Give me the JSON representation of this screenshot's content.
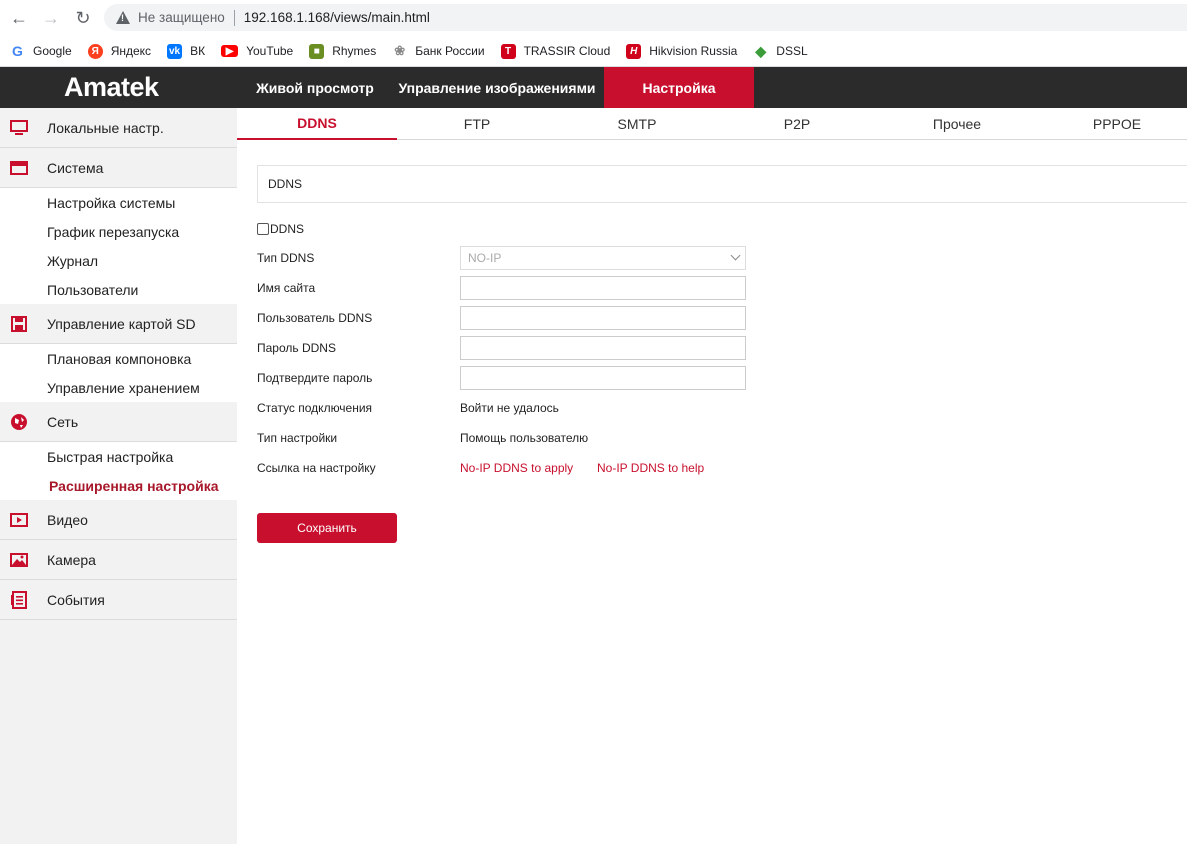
{
  "browser": {
    "insecure_label": "Не защищено",
    "url": "192.168.1.168/views/main.html",
    "bookmarks": [
      {
        "label": "Google",
        "icon": "google-icon",
        "color": "#4285f4"
      },
      {
        "label": "Яндекс",
        "icon": "yandex-icon",
        "color": "#fc3f1d"
      },
      {
        "label": "ВК",
        "icon": "vk-icon",
        "color": "#0077ff"
      },
      {
        "label": "YouTube",
        "icon": "youtube-icon",
        "color": "#ff0000"
      },
      {
        "label": "Rhymes",
        "icon": "rhymes-icon",
        "color": "#6b8e23"
      },
      {
        "label": "Банк России",
        "icon": "cbr-icon",
        "color": "#888888"
      },
      {
        "label": "TRASSIR Cloud",
        "icon": "trassir-icon",
        "color": "#d0021b"
      },
      {
        "label": "Hikvision Russia",
        "icon": "hikvision-icon",
        "color": "#d0021b"
      },
      {
        "label": "DSSL",
        "icon": "dssl-icon",
        "color": "#3a9d3a"
      }
    ]
  },
  "header": {
    "logo": "Amatek",
    "nav": [
      "Живой просмотр",
      "Управление изображениями",
      "Настройка"
    ],
    "active_nav": "Настройка"
  },
  "sidebar": {
    "local": "Локальные настр.",
    "system": "Система",
    "system_items": [
      "Настройка системы",
      "График перезапуска",
      "Журнал",
      "Пользователи"
    ],
    "sd": "Управление картой SD",
    "sd_items": [
      "Плановая компоновка",
      "Управление хранением"
    ],
    "network": "Сеть",
    "network_items": [
      "Быстрая настройка",
      "Расширенная настройка"
    ],
    "video": "Видео",
    "camera": "Камера",
    "events": "События"
  },
  "tabs": [
    "DDNS",
    "FTP",
    "SMTP",
    "P2P",
    "Прочее",
    "PPPOE"
  ],
  "form": {
    "panel_title": "DDNS",
    "enable_label": "DDNS",
    "ddns_type_label": "Тип DDNS",
    "ddns_type_value": "NO-IP",
    "site_name_label": "Имя сайта",
    "user_label": "Пользователь DDNS",
    "password_label": "Пароль DDNS",
    "confirm_label": "Подтвердите пароль",
    "status_label": "Статус подключения",
    "status_value": "Войти не удалось",
    "setup_type_label": "Тип настройки",
    "setup_type_value": "Помощь пользователю",
    "link_label": "Ссылка на настройку",
    "link_apply": "No-IP DDNS to apply",
    "link_help": "No-IP DDNS to help",
    "save": "Сохранить"
  }
}
